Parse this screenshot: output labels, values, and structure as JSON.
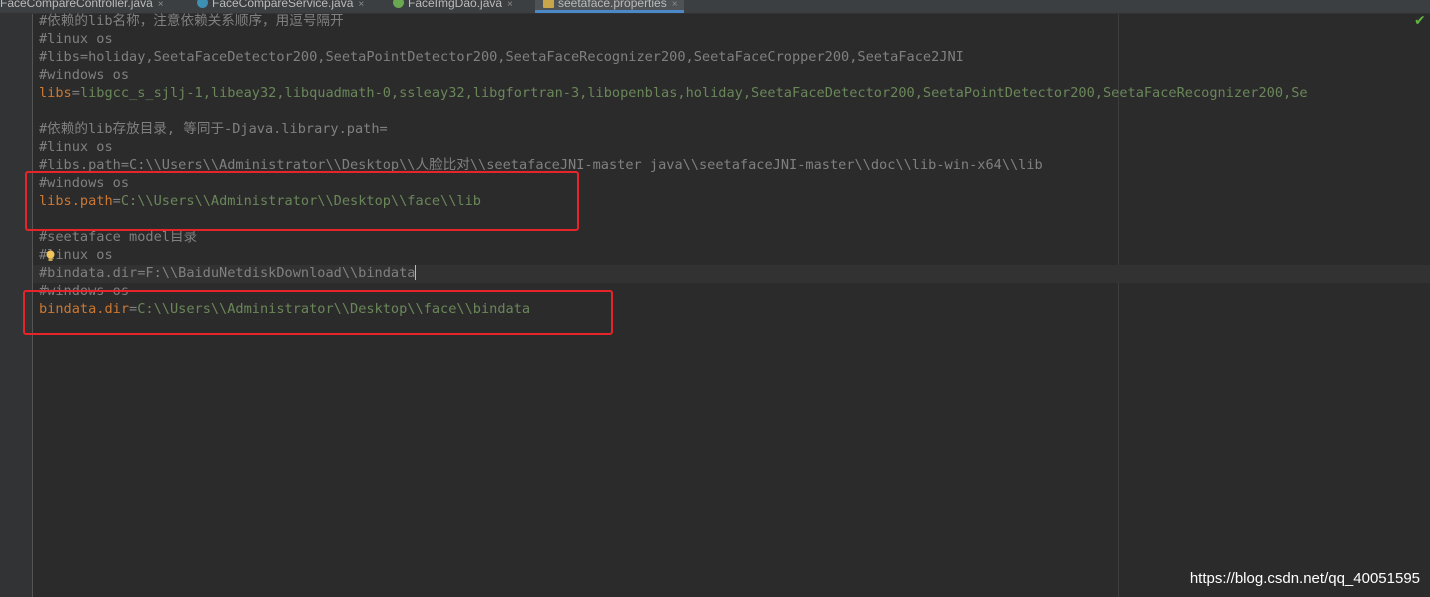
{
  "tabs": [
    {
      "label": "FaceCompareController.java",
      "close": "×",
      "icon": "none",
      "active": false
    },
    {
      "label": "FaceCompareService.java",
      "close": "×",
      "icon": "java-class-icon",
      "active": false
    },
    {
      "label": "FaceImgDao.java",
      "close": "×",
      "icon": "java-interface-icon",
      "active": false
    },
    {
      "label": "seetaface.properties",
      "close": "×",
      "icon": "properties-file-icon",
      "active": true
    }
  ],
  "editor": {
    "lines": [
      "#依赖的lib名称，注意依赖关系顺序，用逗号隔开",
      "#linux os",
      "#libs=holiday,SeetaFaceDetector200,SeetaPointDetector200,SeetaFaceRecognizer200,SeetaFaceCropper200,SeetaFace2JNI",
      "#windows os",
      "libs=libgcc_s_sjlj-1,libeay32,libquadmath-0,ssleay32,libgfortran-3,libopenblas,holiday,SeetaFaceDetector200,SeetaPointDetector200,SeetaFaceRecognizer200,Se",
      "",
      "#依赖的lib存放目录, 等同于-Djava.library.path=",
      "#linux os",
      "#libs.path=C:\\\\Users\\\\Administrator\\\\Desktop\\\\人脸比对\\\\seetafaceJNI-master java\\\\seetafaceJNI-master\\\\doc\\\\lib-win-x64\\\\lib",
      "#windows os",
      "libs.path=C:\\\\Users\\\\Administrator\\\\Desktop\\\\face\\\\lib",
      "",
      "#seetaface model目录",
      "#linux os",
      "#bindata.dir=F:\\\\BaiduNetdiskDownload\\\\bindata",
      "#windows os",
      "bindata.dir=C:\\\\Users\\\\Administrator\\\\Desktop\\\\face\\\\bindata"
    ]
  },
  "status": {
    "check_icon": "✔"
  },
  "watermark": "https://blog.csdn.net/qq_40051595",
  "colors": {
    "highlight_box": "#e8242b",
    "key": "#cc7832",
    "value": "#6a8759",
    "comment": "#808080"
  }
}
